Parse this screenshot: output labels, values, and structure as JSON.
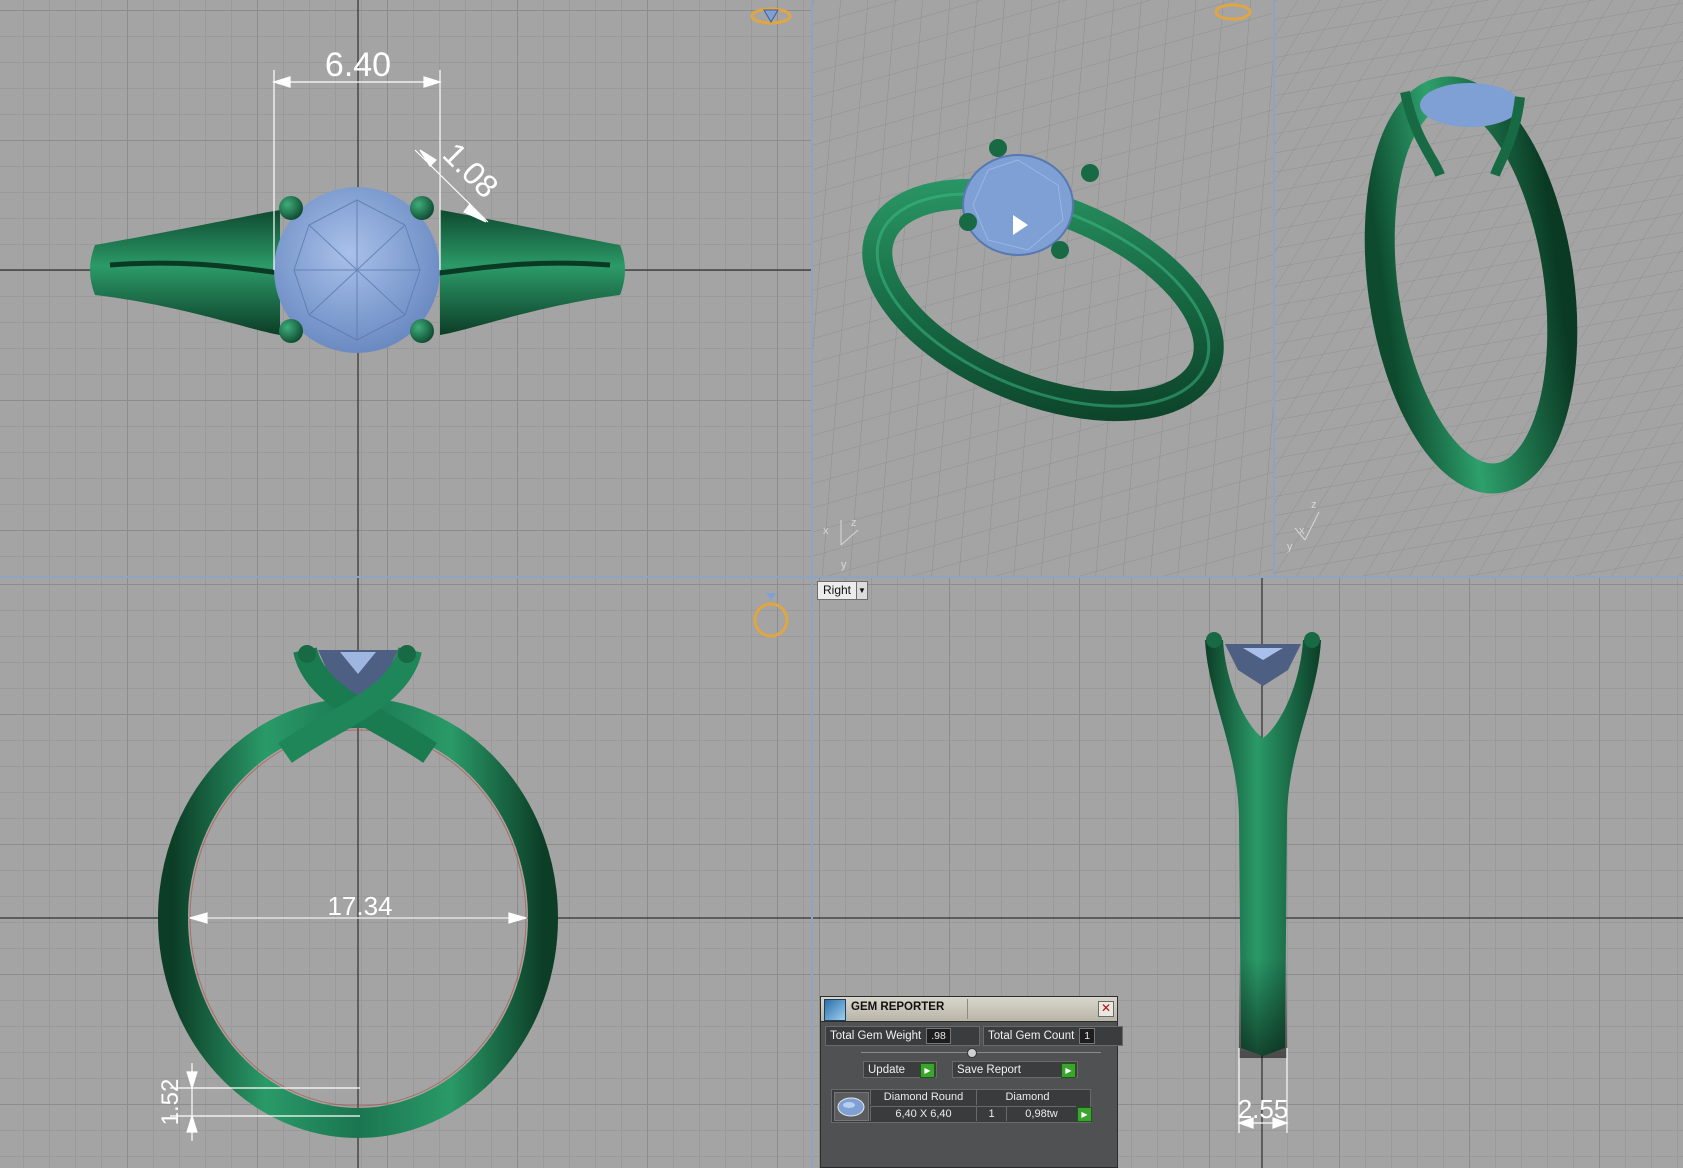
{
  "app": "Rhino / Matrix jewelry CAD",
  "viewports": {
    "top": {
      "dimensions": [
        "6.40",
        "1.08"
      ]
    },
    "perspective_left": {
      "axis_labels": [
        "x",
        "z",
        "y"
      ]
    },
    "perspective_right": {
      "axis_labels": [
        "z",
        "x",
        "y"
      ]
    },
    "front": {
      "dimensions": [
        "17.34",
        "1.52"
      ]
    },
    "right": {
      "view_label": "Right",
      "dimensions": [
        "2.55"
      ]
    }
  },
  "gem_reporter": {
    "title": "GEM REPORTER",
    "total_weight_label": "Total Gem Weight",
    "total_weight_value": ".98",
    "total_count_label": "Total Gem Count",
    "total_count_value": "1",
    "update_label": "Update",
    "save_report_label": "Save Report",
    "gems": [
      {
        "shape": "Diamond Round",
        "material": "Diamond",
        "size": "6,40 X 6,40",
        "count": "1",
        "weight": "0,98tw"
      }
    ]
  },
  "colors": {
    "metal": "#1f7a52",
    "stone": "#7ea0d4",
    "grid_background": "#a4a4a4",
    "panel_background": "#505152",
    "accent_green": "#3aa42c"
  }
}
